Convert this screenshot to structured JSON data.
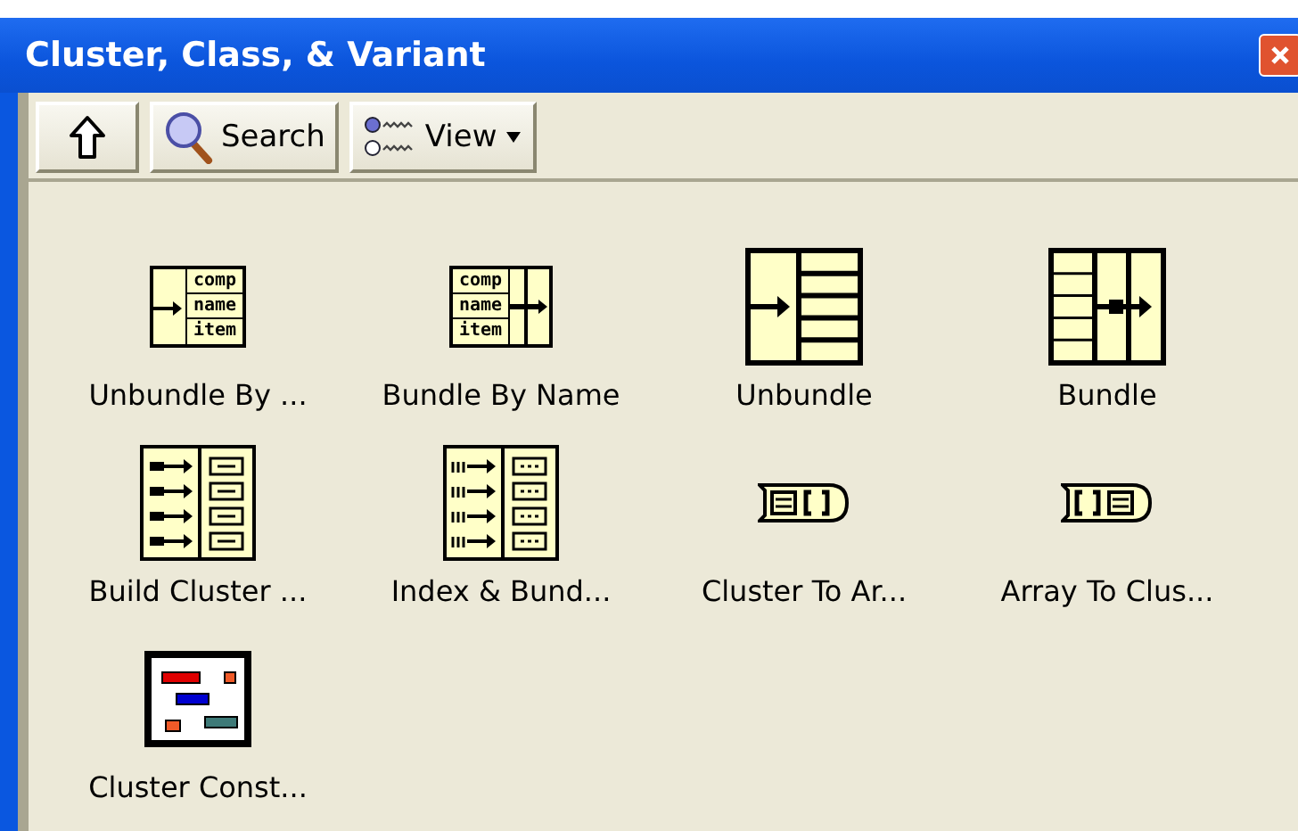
{
  "window": {
    "title": "Cluster, Class, & Variant"
  },
  "toolbar": {
    "buttons": [
      {
        "kind": "up"
      },
      {
        "kind": "search",
        "label": "Search"
      },
      {
        "kind": "view",
        "label": "View"
      }
    ]
  },
  "palette": [
    {
      "kind": "unbundle-by-name",
      "label": "Unbundle By ...",
      "fields": [
        "comp",
        "name",
        "item"
      ]
    },
    {
      "kind": "bundle-by-name",
      "label": "Bundle By Name",
      "fields": [
        "comp",
        "name",
        "item"
      ]
    },
    {
      "kind": "unbundle",
      "label": "Unbundle"
    },
    {
      "kind": "bundle",
      "label": "Bundle"
    },
    {
      "kind": "build-cluster-array",
      "label": "Build Cluster ..."
    },
    {
      "kind": "index-bundle-array",
      "label": "Index & Bund..."
    },
    {
      "kind": "cluster-to-array",
      "label": "Cluster To Ar..."
    },
    {
      "kind": "array-to-cluster",
      "label": "Array To Clus..."
    },
    {
      "kind": "cluster-constant",
      "label": "Cluster Const..."
    }
  ]
}
